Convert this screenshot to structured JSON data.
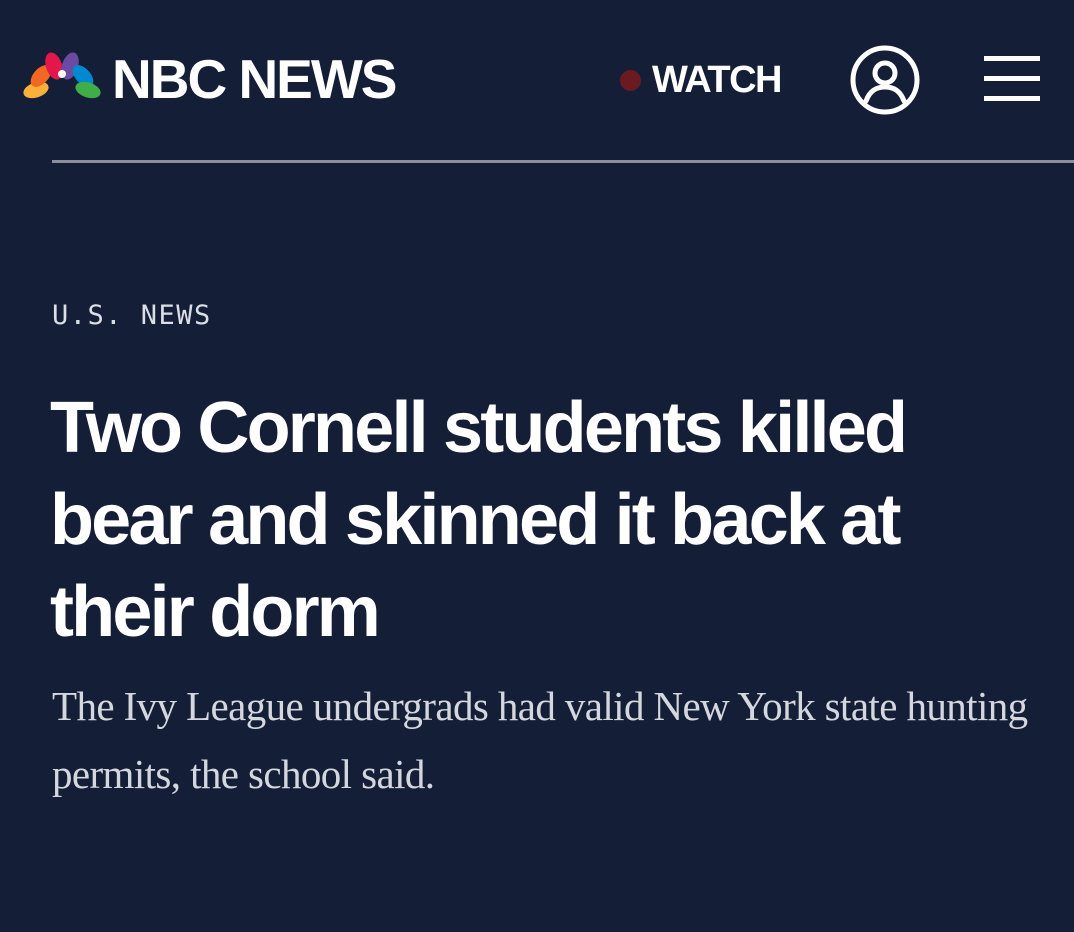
{
  "header": {
    "brand": "NBC NEWS",
    "watch_label": "WATCH",
    "logo_icon": "peacock-logo-icon",
    "account_icon": "account-icon",
    "menu_icon": "hamburger-menu-icon",
    "live_indicator_color": "#6b1a22"
  },
  "article": {
    "section": "U.S. NEWS",
    "headline": "Two Cornell students killed bear and skinned it back at their dorm",
    "dek": "The Ivy League undergrads had valid New York state hunting permits, the school said."
  },
  "colors": {
    "background": "#141e36",
    "divider": "#8a8f9c",
    "text": "#ffffff",
    "peacock": [
      "#fbb03b",
      "#f26722",
      "#e3174a",
      "#6b4ba1",
      "#0089d0",
      "#3fae49"
    ]
  }
}
